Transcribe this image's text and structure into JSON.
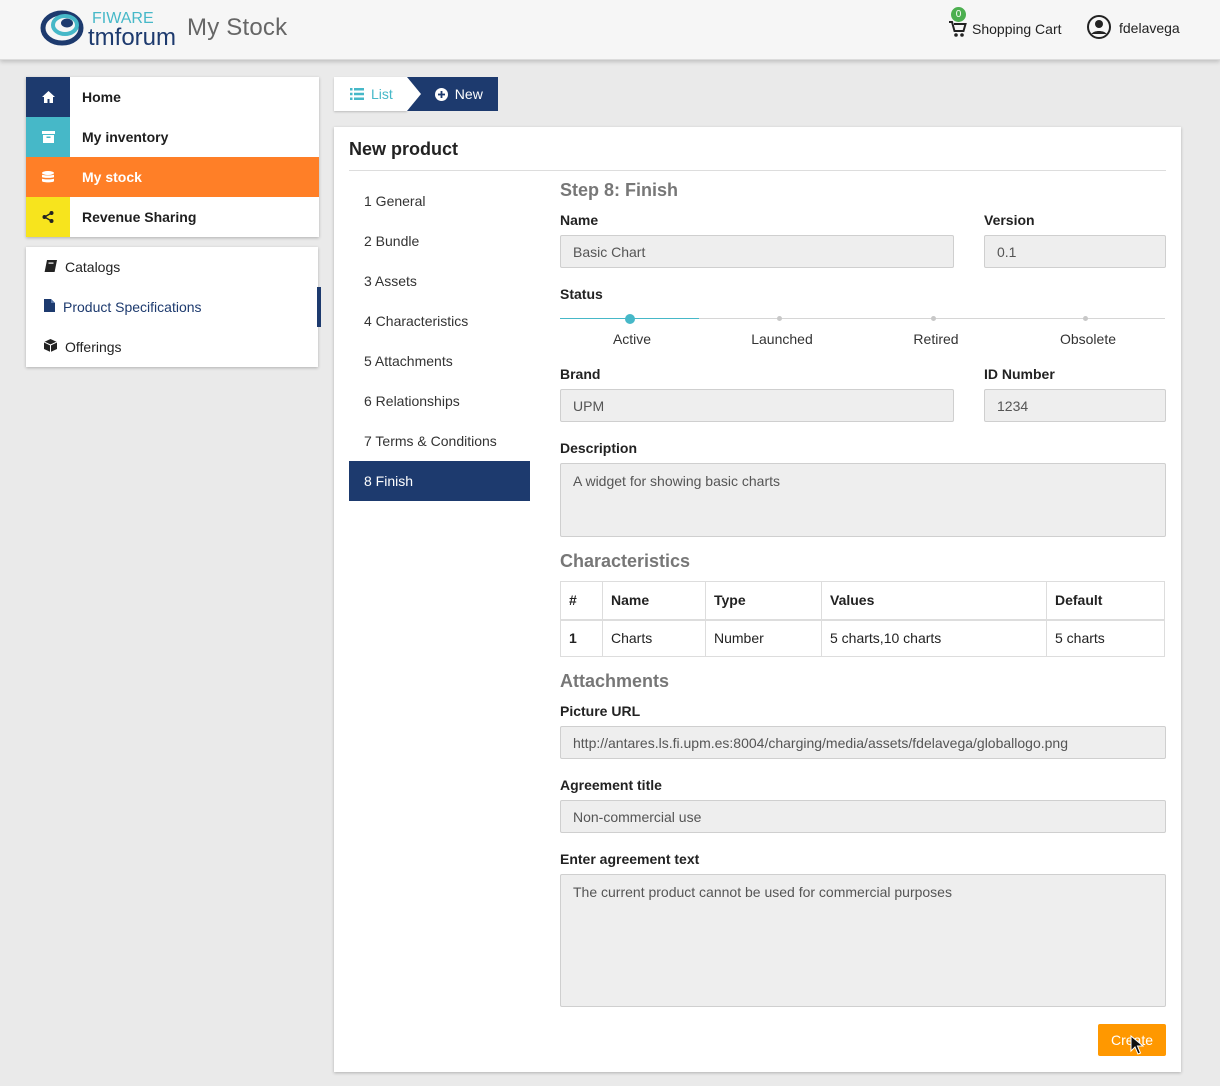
{
  "header": {
    "logo_top": "FIWARE",
    "logo_bottom": "tmforum",
    "app_title": "My Stock",
    "cart_count": "0",
    "cart_label": "Shopping Cart",
    "user_name": "fdelavega"
  },
  "sidebar": {
    "main": [
      {
        "label": "Home",
        "icon": "home-icon"
      },
      {
        "label": "My inventory",
        "icon": "archive-icon"
      },
      {
        "label": "My stock",
        "icon": "database-icon"
      },
      {
        "label": "Revenue Sharing",
        "icon": "share-icon"
      }
    ],
    "sub": [
      {
        "label": "Catalogs",
        "icon": "book-icon"
      },
      {
        "label": "Product Specifications",
        "icon": "file-icon"
      },
      {
        "label": "Offerings",
        "icon": "cube-icon"
      }
    ]
  },
  "breadcrumb": {
    "list": "List",
    "new": "New"
  },
  "panel": {
    "title": "New product",
    "steps": [
      "1 General",
      "2 Bundle",
      "3 Assets",
      "4 Characteristics",
      "5 Attachments",
      "6 Relationships",
      "7 Terms & Conditions",
      "8 Finish"
    ],
    "step_heading": "Step 8: Finish",
    "labels": {
      "name": "Name",
      "version": "Version",
      "status": "Status",
      "brand": "Brand",
      "id_number": "ID Number",
      "description": "Description",
      "picture_url": "Picture URL",
      "agreement_title": "Agreement title",
      "agreement_text": "Enter agreement text"
    },
    "values": {
      "name": "Basic Chart",
      "version": "0.1",
      "brand": "UPM",
      "id_number": "1234",
      "description": "A widget for showing basic charts",
      "picture_url": "http://antares.ls.fi.upm.es:8004/charging/media/assets/fdelavega/globallogo.png",
      "agreement_title": "Non-commercial use",
      "agreement_text": "The current product cannot be used for commercial purposes"
    },
    "status_options": [
      "Active",
      "Launched",
      "Retired",
      "Obsolete"
    ],
    "status_selected": "Active",
    "characteristics_heading": "Characteristics",
    "table": {
      "headers": [
        "#",
        "Name",
        "Type",
        "Values",
        "Default"
      ],
      "rows": [
        [
          "1",
          "Charts",
          "Number",
          "5 charts,10 charts",
          "5 charts"
        ]
      ]
    },
    "attachments_heading": "Attachments",
    "create_label": "Create"
  },
  "colors": {
    "navy": "#1d3a6e",
    "teal": "#46b8c8",
    "orange": "#ff7f27",
    "yellow": "#f7e41d",
    "button_orange": "#ff9800",
    "badge_green": "#4caf50"
  }
}
